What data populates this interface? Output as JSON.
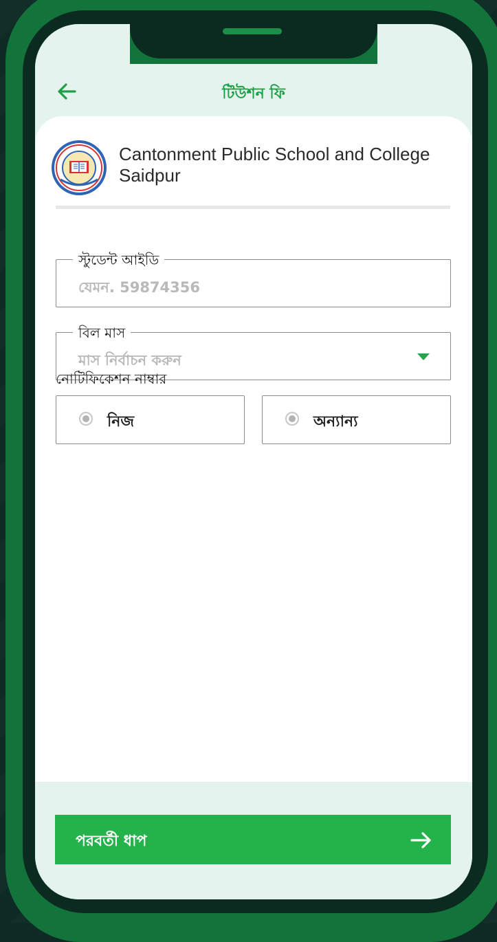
{
  "header": {
    "back_icon": "arrow-left-icon",
    "title": "টিউশন ফি"
  },
  "school": {
    "name": "Cantonment Public School and College Saidpur",
    "logo_icon": "school-crest-logo"
  },
  "form": {
    "student_id": {
      "label": "স্টুডেন্ট আইডি",
      "placeholder": "যেমন. 59874356"
    },
    "bill_month": {
      "label": "বিল মাস",
      "placeholder": "মাস নির্বাচন করুন",
      "dropdown_icon": "caret-down-icon"
    },
    "notification": {
      "label": "নোটিফিকেশন নাম্বার",
      "options": [
        {
          "label": "নিজ"
        },
        {
          "label": "অন্যান্য"
        }
      ]
    }
  },
  "footer": {
    "next_label": "পরবর্তী ধাপ",
    "next_icon": "arrow-right-icon"
  },
  "colors": {
    "accent": "#24b24b",
    "frame": "#12743a",
    "screen_bg": "#e4f3ee"
  }
}
